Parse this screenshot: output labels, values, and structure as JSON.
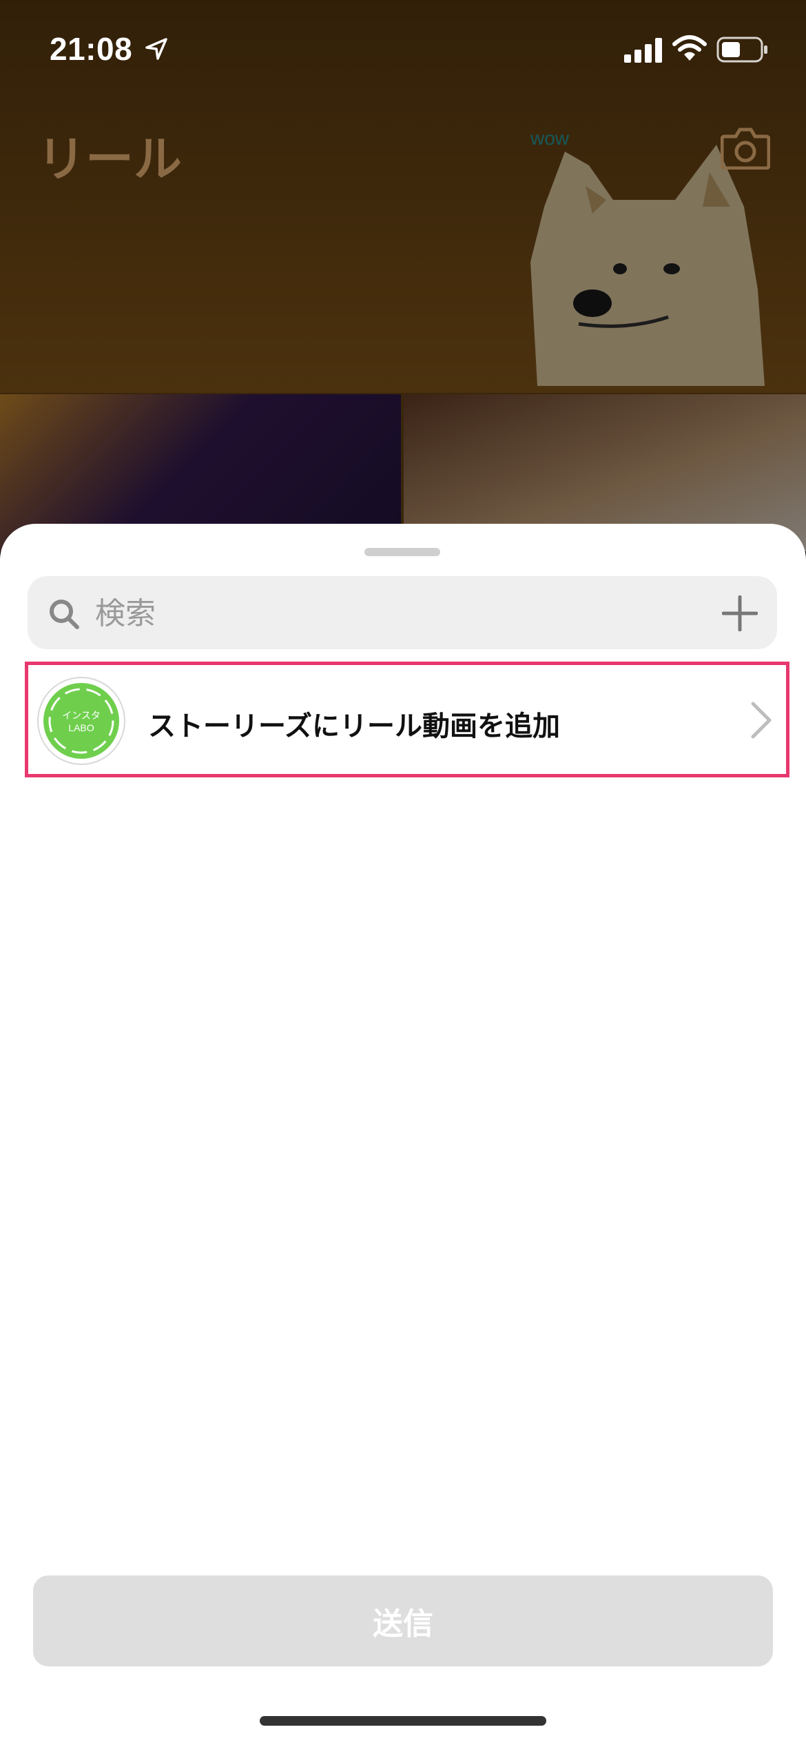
{
  "status_bar": {
    "time": "21:08",
    "icons": [
      "location-arrow-icon",
      "cellular-signal-icon",
      "wifi-icon",
      "battery-icon"
    ]
  },
  "background": {
    "title": "リール",
    "camera_icon": "camera-icon",
    "sticker_text": "wow"
  },
  "sheet": {
    "search": {
      "placeholder": "検索",
      "value": ""
    },
    "items": [
      {
        "label": "ストーリーズにリール動画を追加",
        "avatar_text": "インスタ LABO",
        "selected": true
      }
    ],
    "send_label": "送信"
  },
  "colors": {
    "highlight_border": "#e8386d",
    "avatar_green": "#6fcf4d",
    "send_disabled_bg": "#dedede"
  }
}
